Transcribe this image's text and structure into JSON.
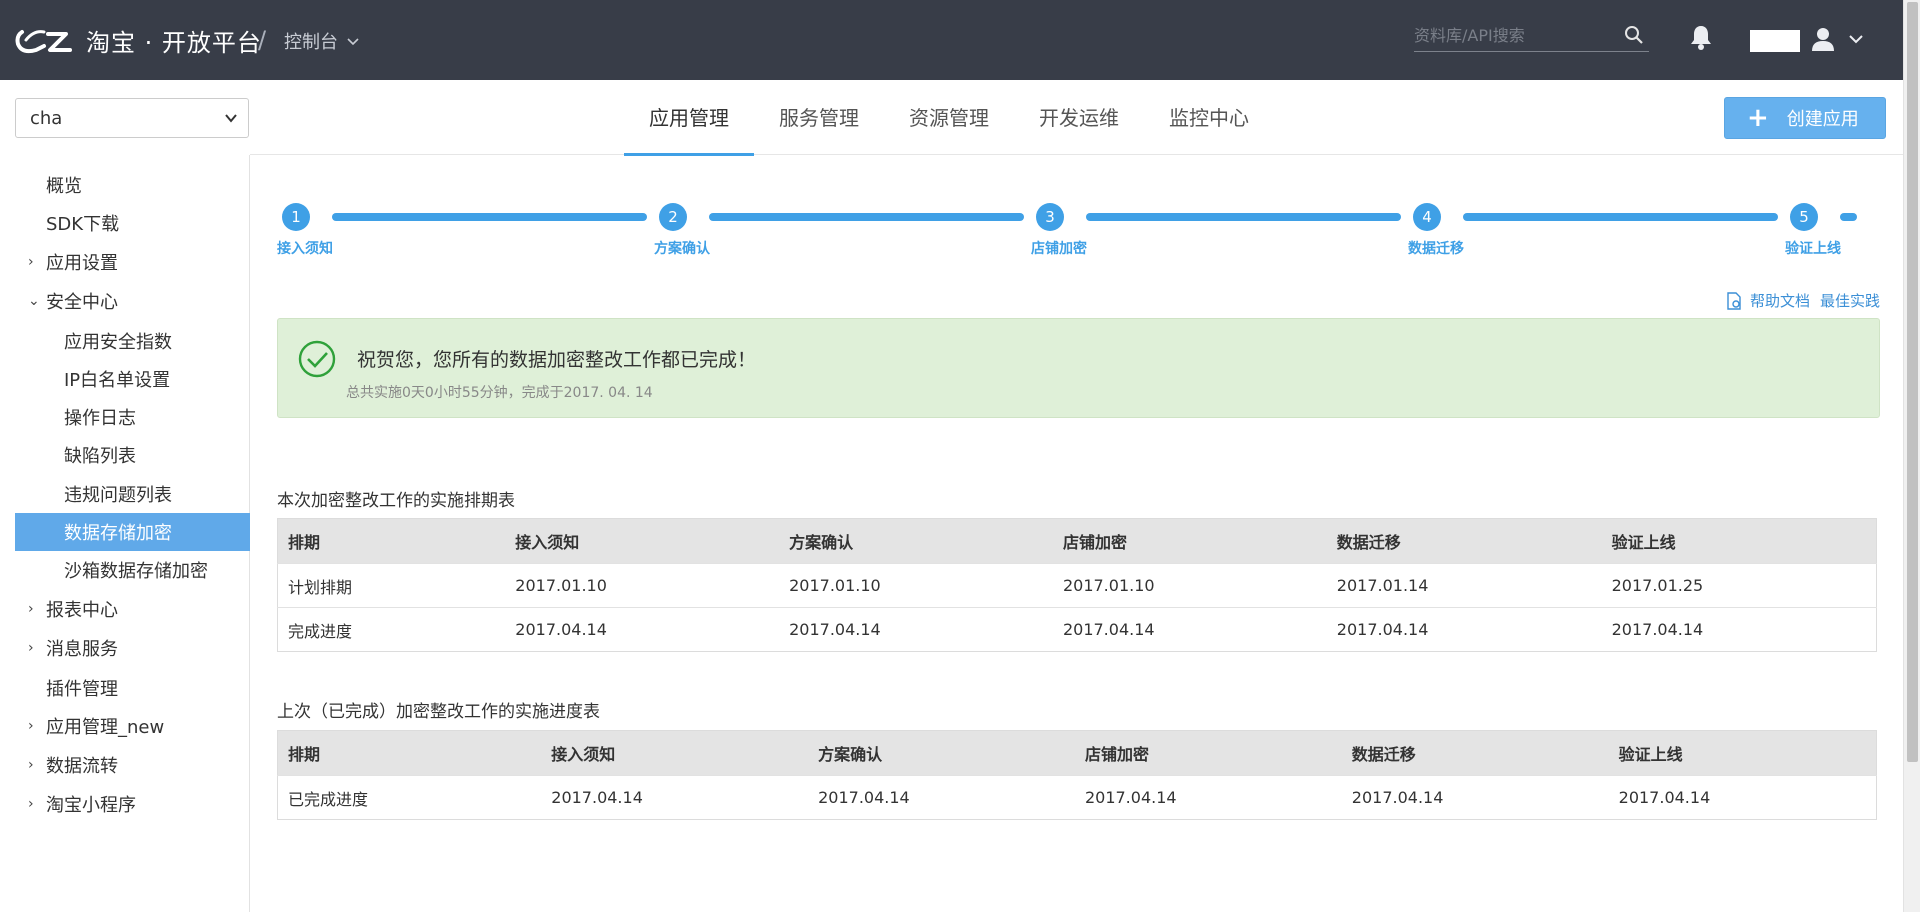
{
  "header": {
    "logo_text": "淘宝 · 开放平台",
    "separator": "/",
    "console_label": "控制台",
    "search_placeholder": "资料库/API搜索"
  },
  "app_select": {
    "value": "cha"
  },
  "nav": {
    "tabs": [
      "应用管理",
      "服务管理",
      "资源管理",
      "开发运维",
      "监控中心"
    ],
    "active_tab": "应用管理",
    "create_button": "创建应用"
  },
  "sidebar": {
    "items": [
      {
        "label": "概览",
        "arrow": ""
      },
      {
        "label": "SDK下载",
        "arrow": ""
      },
      {
        "label": "应用设置",
        "arrow": "›"
      },
      {
        "label": "安全中心",
        "arrow": "⌄"
      },
      {
        "label": "应用安全指数",
        "arrow": ""
      },
      {
        "label": "IP白名单设置",
        "arrow": ""
      },
      {
        "label": "操作日志",
        "arrow": ""
      },
      {
        "label": "缺陷列表",
        "arrow": ""
      },
      {
        "label": "违规问题列表",
        "arrow": ""
      },
      {
        "label": "数据存储加密",
        "arrow": ""
      },
      {
        "label": "沙箱数据存储加密",
        "arrow": ""
      },
      {
        "label": "报表中心",
        "arrow": "›"
      },
      {
        "label": "消息服务",
        "arrow": "›"
      },
      {
        "label": "插件管理",
        "arrow": ""
      },
      {
        "label": "应用管理_new",
        "arrow": "›"
      },
      {
        "label": "数据流转",
        "arrow": "›"
      },
      {
        "label": "淘宝小程序",
        "arrow": "›"
      }
    ],
    "active": "数据存储加密"
  },
  "steps": [
    {
      "num": "1",
      "label": "接入须知"
    },
    {
      "num": "2",
      "label": "方案确认"
    },
    {
      "num": "3",
      "label": "店铺加密"
    },
    {
      "num": "4",
      "label": "数据迁移"
    },
    {
      "num": "5",
      "label": "验证上线"
    }
  ],
  "help_links": {
    "doc": "帮助文档",
    "best_practice": "最佳实践"
  },
  "success_message": {
    "title": "祝贺您，您所有的数据加密整改工作都已完成！",
    "subtitle": "总共实施0天0小时55分钟，完成于2017. 04. 14"
  },
  "schedule_table": {
    "title": "本次加密整改工作的实施排期表",
    "headers": [
      "排期",
      "接入须知",
      "方案确认",
      "店铺加密",
      "数据迁移",
      "验证上线"
    ],
    "rows": [
      [
        "计划排期",
        "2017.01.10",
        "2017.01.10",
        "2017.01.10",
        "2017.01.14",
        "2017.01.25"
      ],
      [
        "完成进度",
        "2017.04.14",
        "2017.04.14",
        "2017.04.14",
        "2017.04.14",
        "2017.04.14"
      ]
    ]
  },
  "progress_table": {
    "title": "上次（已完成）加密整改工作的实施进度表",
    "headers": [
      "排期",
      "接入须知",
      "方案确认",
      "店铺加密",
      "数据迁移",
      "验证上线"
    ],
    "rows": [
      [
        "已完成进度",
        "2017.04.14",
        "2017.04.14",
        "2017.04.14",
        "2017.04.14",
        "2017.04.14"
      ]
    ]
  },
  "colors": {
    "topbar": "#383d48",
    "accent": "#3fa0e6",
    "sidebar_active": "#60a9e9",
    "success_bg": "#dff0d8"
  }
}
